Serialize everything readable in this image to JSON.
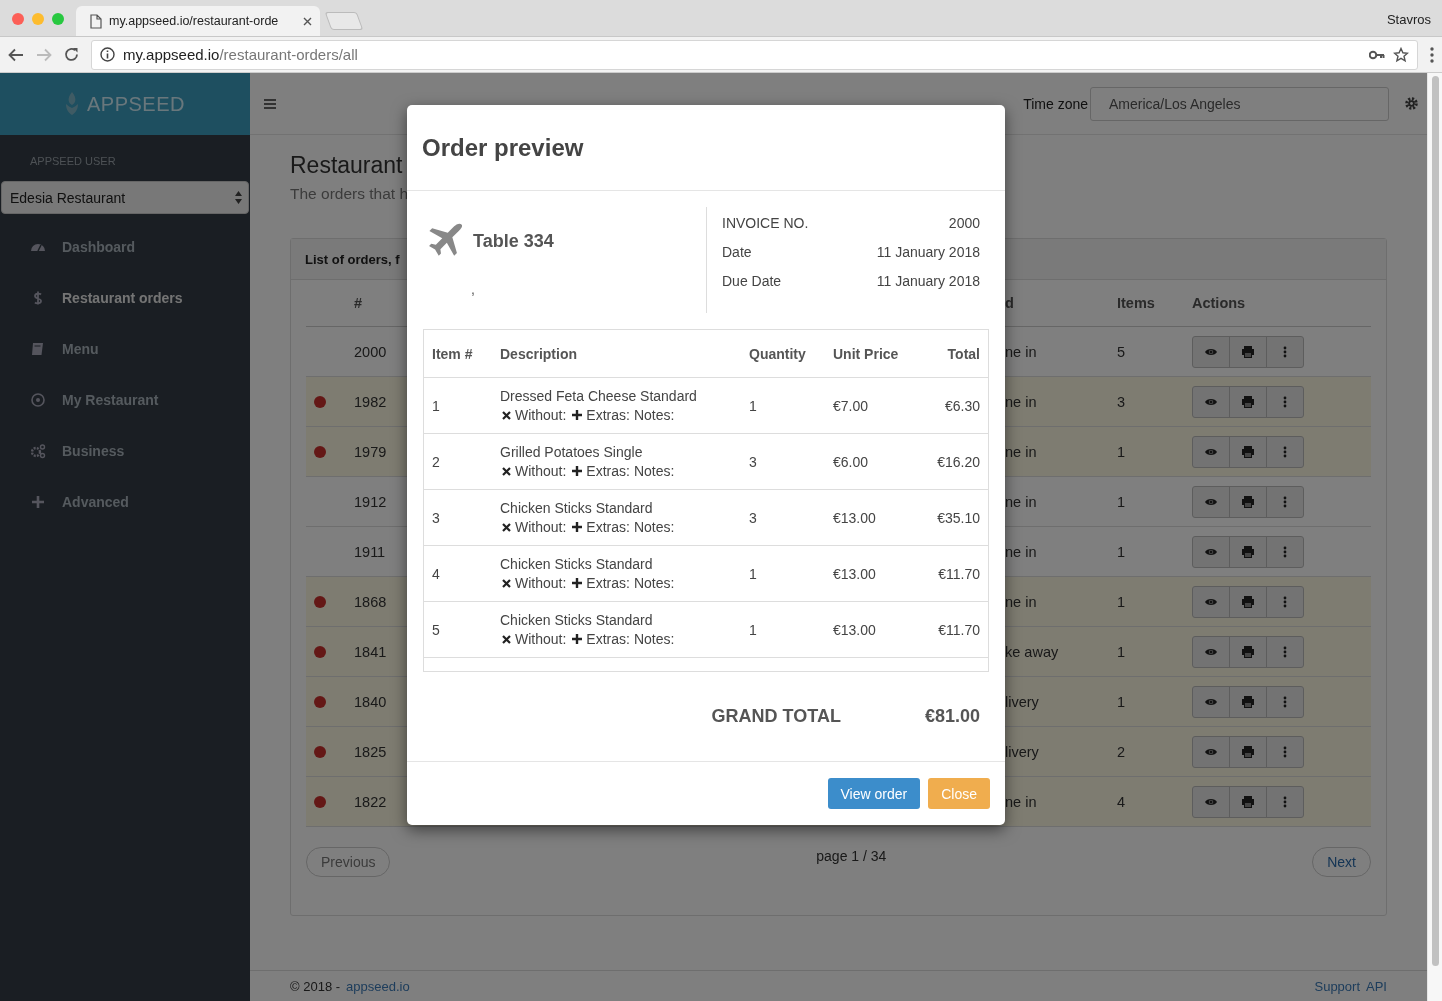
{
  "browser": {
    "tab_title": "my.appseed.io/restaurant-orde",
    "url_host": "my.appseed.io",
    "url_path": "/restaurant-orders/all",
    "profile": "Stavros"
  },
  "sidebar": {
    "brand": "APPSEED",
    "user_label": "APPSEED USER",
    "restaurant_select": "Edesia Restaurant",
    "items": [
      {
        "label": "Dashboard",
        "kind": "dashboard",
        "selected": false
      },
      {
        "label": "Restaurant orders",
        "kind": "dollar",
        "selected": true
      },
      {
        "label": "Menu",
        "kind": "book",
        "selected": false
      },
      {
        "label": "My Restaurant",
        "kind": "target",
        "selected": false
      },
      {
        "label": "Business",
        "kind": "gears",
        "selected": false
      },
      {
        "label": "Advanced",
        "kind": "plus",
        "selected": false
      }
    ]
  },
  "topbar": {
    "timezone_label": "Time zone",
    "timezone_value": "America/Los Angeles"
  },
  "page": {
    "title": "Restaurant",
    "subtitle": "The orders that h",
    "panel_title": "List of orders, f",
    "columns": [
      "#",
      "d",
      "Items",
      "Actions"
    ],
    "rows": [
      {
        "number": "2000",
        "unpaid": false,
        "type": "ne in",
        "items": "5"
      },
      {
        "number": "1982",
        "unpaid": true,
        "type": "ne in",
        "items": "3"
      },
      {
        "number": "1979",
        "unpaid": true,
        "type": "ne in",
        "items": "1"
      },
      {
        "number": "1912",
        "unpaid": false,
        "type": "ne in",
        "items": "1"
      },
      {
        "number": "1911",
        "unpaid": false,
        "type": "ne in",
        "items": "1"
      },
      {
        "number": "1868",
        "unpaid": true,
        "type": "ne in",
        "items": "1"
      },
      {
        "number": "1841",
        "unpaid": true,
        "type": "ke away",
        "items": "1"
      },
      {
        "number": "1840",
        "unpaid": true,
        "type": "livery",
        "items": "1"
      },
      {
        "number": "1825",
        "unpaid": true,
        "type": "livery",
        "items": "2"
      },
      {
        "number": "1822",
        "unpaid": true,
        "type": "ne in",
        "items": "4"
      }
    ],
    "pagination": {
      "previous": "Previous",
      "page": "page 1 / 34",
      "next": "Next"
    }
  },
  "footer": {
    "copyright": "© 2018 -",
    "link": "appseed.io",
    "links": [
      "Support",
      "API"
    ]
  },
  "modal": {
    "title": "Order preview",
    "table_name": "Table 334",
    "address": ",",
    "invoice": [
      {
        "label": "INVOICE NO.",
        "value": "2000"
      },
      {
        "label": "Date",
        "value": "11 January 2018"
      },
      {
        "label": "Due Date",
        "value": "11 January 2018"
      }
    ],
    "columns": [
      "Item #",
      "Description",
      "Quantity",
      "Unit Price",
      "Total"
    ],
    "items": [
      {
        "number": "1",
        "name": "Dressed Feta Cheese Standard",
        "without": "Without:",
        "extras": "Extras:",
        "notes": "Notes:",
        "quantity": "1",
        "unit_price": "€7.00",
        "total": "€6.30"
      },
      {
        "number": "2",
        "name": "Grilled Potatoes Single",
        "without": "Without:",
        "extras": "Extras:",
        "notes": "Notes:",
        "quantity": "3",
        "unit_price": "€6.00",
        "total": "€16.20"
      },
      {
        "number": "3",
        "name": "Chicken Sticks Standard",
        "without": "Without:",
        "extras": "Extras:",
        "notes": "Notes:",
        "quantity": "3",
        "unit_price": "€13.00",
        "total": "€35.10"
      },
      {
        "number": "4",
        "name": "Chicken Sticks Standard",
        "without": "Without:",
        "extras": "Extras:",
        "notes": "Notes:",
        "quantity": "1",
        "unit_price": "€13.00",
        "total": "€11.70"
      },
      {
        "number": "5",
        "name": "Chicken Sticks Standard",
        "without": "Without:",
        "extras": "Extras:",
        "notes": "Notes:",
        "quantity": "1",
        "unit_price": "€13.00",
        "total": "€11.70"
      }
    ],
    "grand_total_label": "GRAND TOTAL",
    "grand_total": "€81.00",
    "buttons": [
      {
        "label": "View order",
        "kind": "primary"
      },
      {
        "label": "Close",
        "kind": "warning"
      }
    ]
  }
}
